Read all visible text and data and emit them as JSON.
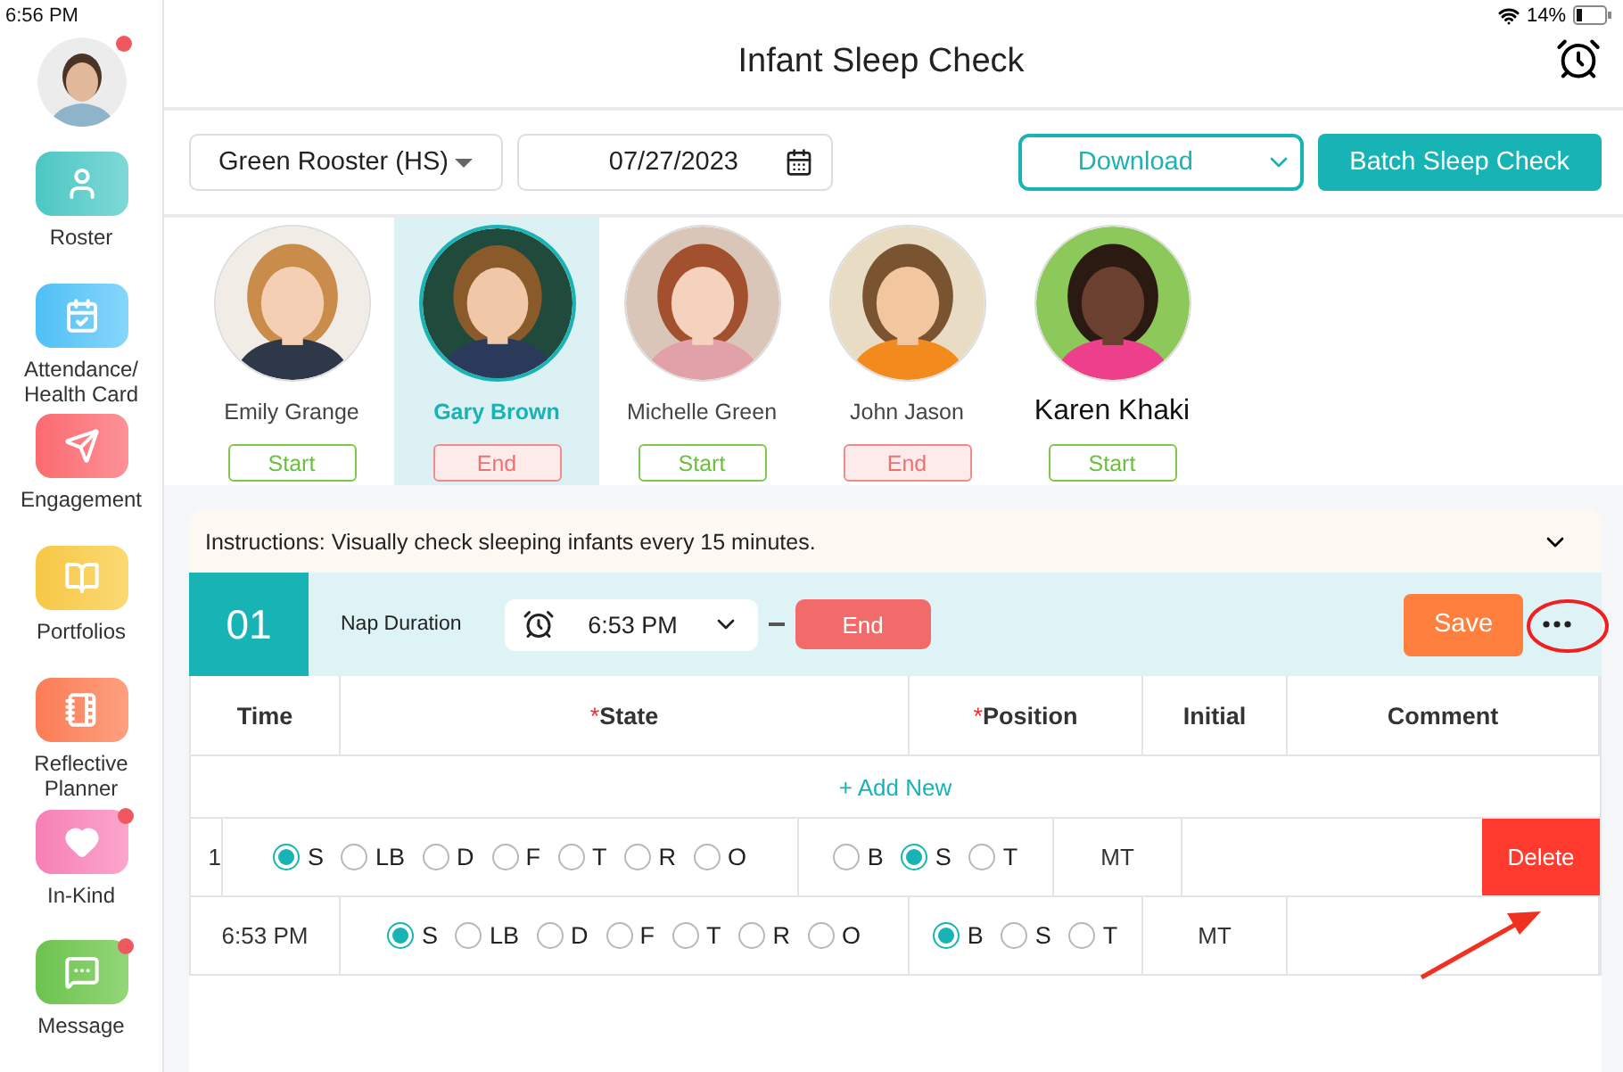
{
  "status_bar": {
    "time": "6:56 PM",
    "battery": "14%"
  },
  "profile": {
    "badge": true
  },
  "sidebar": {
    "items": [
      {
        "kind": "roster",
        "label": "Roster",
        "badge": false
      },
      {
        "kind": "attendance",
        "label": "Attendance/ Health Card",
        "badge": false
      },
      {
        "kind": "engagement",
        "label": "Engagement",
        "badge": false
      },
      {
        "kind": "portfolios",
        "label": "Portfolios",
        "badge": false
      },
      {
        "kind": "planner",
        "label": "Reflective Planner",
        "badge": false
      },
      {
        "kind": "inkind",
        "label": "In-Kind",
        "badge": true
      },
      {
        "kind": "message",
        "label": "Message",
        "badge": true
      }
    ]
  },
  "header": {
    "title": "Infant Sleep Check"
  },
  "toolbar": {
    "classroom": "Green Rooster (HS)",
    "date": "07/27/2023",
    "download": "Download",
    "batch": "Batch Sleep Check"
  },
  "children": [
    {
      "name": "Emily Grange",
      "selected": false,
      "emphasized": false,
      "action": {
        "kind": "start",
        "label": "Start"
      }
    },
    {
      "name": "Gary Brown",
      "selected": true,
      "emphasized": false,
      "action": {
        "kind": "end",
        "label": "End"
      }
    },
    {
      "name": "Michelle Green",
      "selected": false,
      "emphasized": false,
      "action": {
        "kind": "start",
        "label": "Start"
      }
    },
    {
      "name": "John Jason",
      "selected": false,
      "emphasized": false,
      "action": {
        "kind": "end",
        "label": "End"
      }
    },
    {
      "name": "Karen Khaki",
      "selected": false,
      "emphasized": true,
      "action": {
        "kind": "start",
        "label": "Start"
      }
    }
  ],
  "instructions": {
    "text": "Instructions: Visually check sleeping infants every 15 minutes.",
    "expanded": false
  },
  "nap": {
    "number": "01",
    "label": "Nap Duration",
    "start_time": "6:53 PM",
    "end": "End",
    "save": "Save"
  },
  "table": {
    "columns": [
      {
        "label": "Time"
      },
      {
        "label": "State",
        "marker": "*"
      },
      {
        "label": "Position",
        "marker": "*"
      },
      {
        "label": "Initial"
      },
      {
        "label": "Comment"
      }
    ],
    "add_new": "+ Add New",
    "rows": [
      {
        "time": "1",
        "swiped": true,
        "delete": "Delete",
        "initial": "MT",
        "state": [
          {
            "label": "S",
            "selected": true
          },
          {
            "label": "LB",
            "selected": false
          },
          {
            "label": "D",
            "selected": false
          },
          {
            "label": "F",
            "selected": false
          },
          {
            "label": "T",
            "selected": false
          },
          {
            "label": "R",
            "selected": false
          },
          {
            "label": "O",
            "selected": false
          }
        ],
        "position": [
          {
            "label": "B",
            "selected": false
          },
          {
            "label": "S",
            "selected": true
          },
          {
            "label": "T",
            "selected": false
          }
        ]
      },
      {
        "time": "6:53 PM",
        "swiped": false,
        "initial": "MT",
        "state": [
          {
            "label": "S",
            "selected": true
          },
          {
            "label": "LB",
            "selected": false
          },
          {
            "label": "D",
            "selected": false
          },
          {
            "label": "F",
            "selected": false
          },
          {
            "label": "T",
            "selected": false
          },
          {
            "label": "R",
            "selected": false
          },
          {
            "label": "O",
            "selected": false
          }
        ],
        "position": [
          {
            "label": "B",
            "selected": true
          },
          {
            "label": "S",
            "selected": false
          },
          {
            "label": "T",
            "selected": false
          }
        ]
      }
    ]
  }
}
